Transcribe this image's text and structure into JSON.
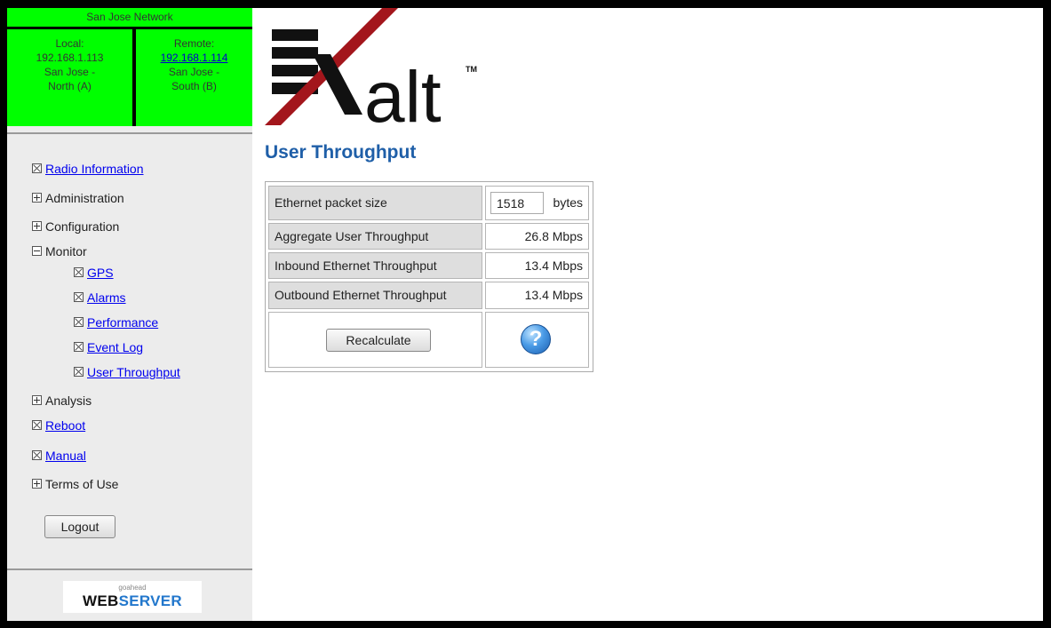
{
  "network": {
    "title": "San Jose Network",
    "local": {
      "heading": "Local:",
      "ip": "192.168.1.113",
      "site_line1": "San Jose -",
      "site_line2": "North (A)"
    },
    "remote": {
      "heading": "Remote:",
      "ip": "192.168.1.114",
      "site_line1": "San Jose -",
      "site_line2": "South (B)"
    }
  },
  "nav": {
    "radio_information": "Radio Information",
    "administration": "Administration",
    "configuration": "Configuration",
    "monitor": "Monitor",
    "gps": "GPS",
    "alarms": "Alarms",
    "performance": "Performance",
    "event_log": "Event Log",
    "user_throughput": "User Throughput",
    "analysis": "Analysis",
    "reboot": "Reboot",
    "manual": "Manual",
    "terms_of_use": "Terms of Use"
  },
  "logout_label": "Logout",
  "footer": {
    "small": "goahead",
    "web": "WEB",
    "server": "SERVER"
  },
  "logo": {
    "text": "alt",
    "tm": "TM"
  },
  "page_title": "User Throughput",
  "throughput": {
    "packet_size_label": "Ethernet packet size",
    "packet_size_value": "1518",
    "packet_size_unit": "bytes",
    "aggregate_label": "Aggregate User Throughput",
    "aggregate_value": "26.8 Mbps",
    "inbound_label": "Inbound Ethernet Throughput",
    "inbound_value": "13.4 Mbps",
    "outbound_label": "Outbound Ethernet Throughput",
    "outbound_value": "13.4 Mbps",
    "recalculate_label": "Recalculate",
    "help_glyph": "?"
  },
  "colors": {
    "network_green": "#00ff00",
    "title_blue": "#1f5fa8",
    "logo_red": "#a3161c"
  }
}
